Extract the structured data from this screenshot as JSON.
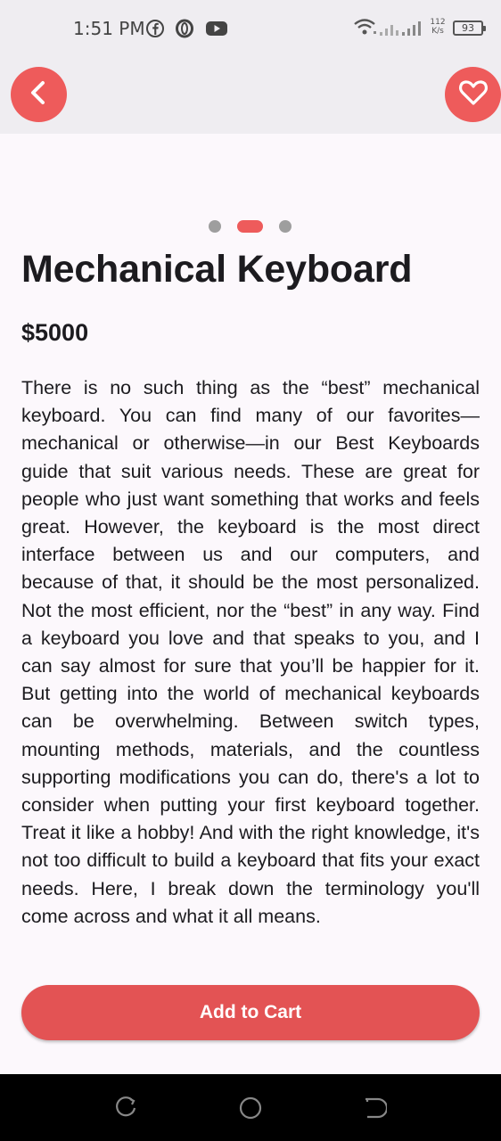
{
  "status_bar": {
    "time": "1:51 PM",
    "left_icons": [
      "facebook-icon",
      "opera-icon",
      "youtube-icon"
    ],
    "right_icons": [
      "wifi-icon",
      "signal-icon"
    ],
    "net_speed_value": "112",
    "net_speed_unit": "K/s",
    "battery": "93"
  },
  "app_bar": {
    "back_icon": "chevron-left-icon",
    "favorite_icon": "heart-icon",
    "accent_color": "#ee5b5b"
  },
  "carousel": {
    "total": 3,
    "active_index": 1
  },
  "product": {
    "title": "Mechanical Keyboard",
    "price": "$5000",
    "description": "There is no such thing as the “best” mechanical keyboard. You can find many of our favorites—mechanical or otherwise—in our Best Keyboards guide that suit various needs. These are great for people who just want something that works and feels great. However, the keyboard is the most direct interface between us and our computers, and because of that, it should be the most personalized. Not the most efficient, nor the “best” in any way. Find a keyboard you love and that speaks to you, and I can say almost for sure that you’ll be happier for it. But getting into the world of mechanical keyboards can be overwhelming. Between switch types, mounting methods, materials, and the countless supporting modifications you can do, there's a lot to consider when putting your first keyboard together. Treat it like a hobby! And with the right knowledge, it's not too difficult to build a keyboard that fits your exact needs. Here, I break down the terminology you'll come across and what it all means."
  },
  "actions": {
    "add_to_cart_label": "Add to Cart",
    "button_color": "#e35354"
  },
  "nav_bar": {
    "icons": [
      "recent-apps-icon",
      "home-icon",
      "back-nav-icon"
    ]
  }
}
